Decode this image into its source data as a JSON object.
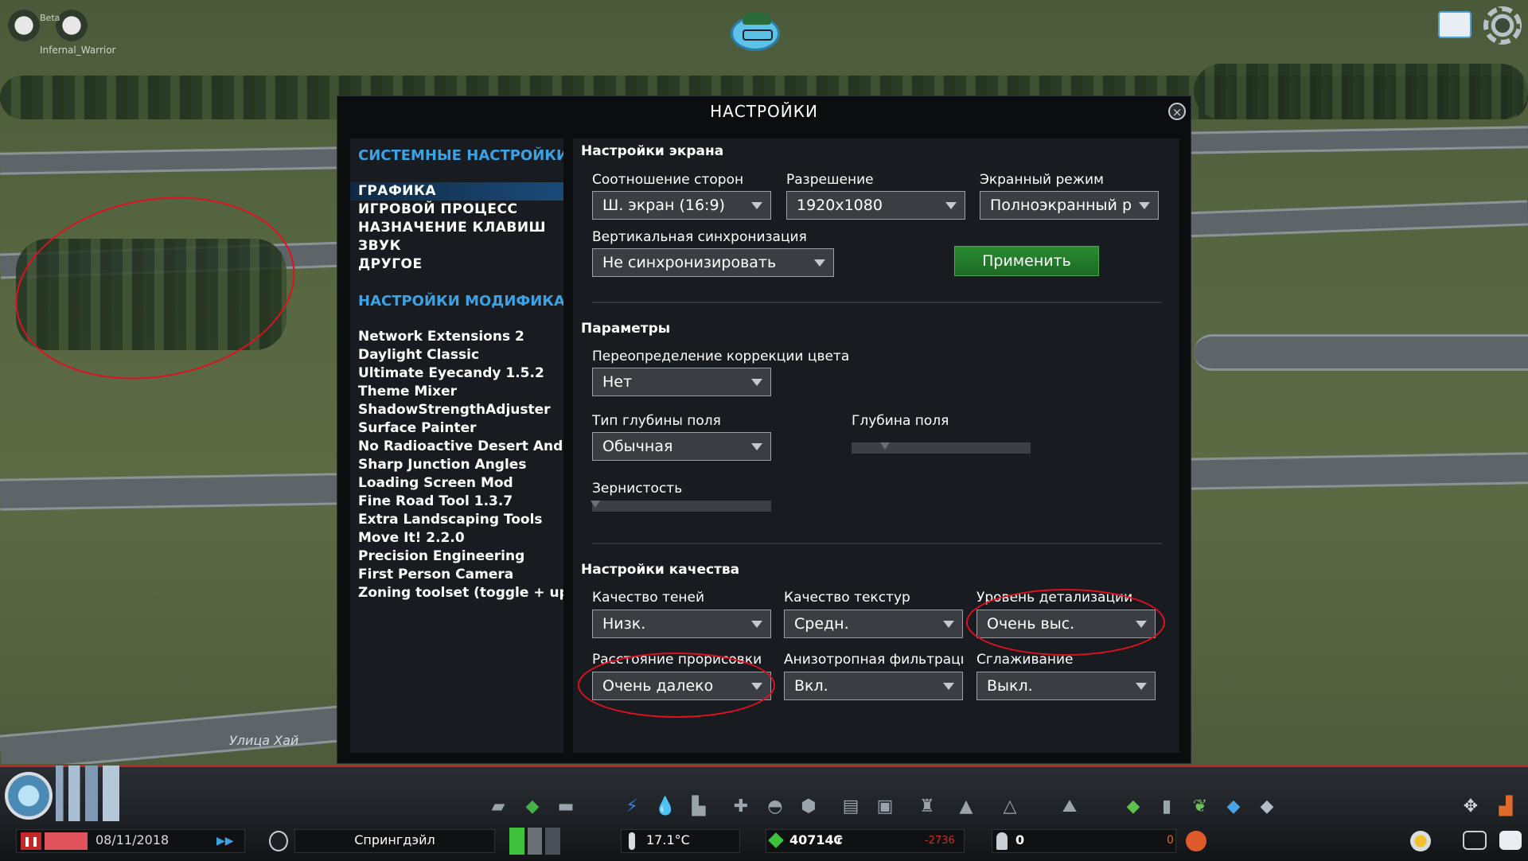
{
  "top": {
    "username": "Infernal_Warrior",
    "beta_label": "Beta"
  },
  "world": {
    "street_name": "Улица Хай"
  },
  "dialog": {
    "title": "НАСТРОЙКИ",
    "close_symbol": "×",
    "nav": {
      "system_header": "СИСТЕМНЫЕ НАСТРОЙКИ",
      "items": [
        "ГРАФИКА",
        "ИГРОВОЙ ПРОЦЕСС",
        "НАЗНАЧЕНИЕ КЛАВИШ",
        "ЗВУК",
        "ДРУГОЕ"
      ],
      "active_index": 0,
      "mods_header": "НАСТРОЙКИ МОДИФИКАЦИЙ",
      "mods": [
        "Network Extensions 2",
        "Daylight Classic",
        "Ultimate Eyecandy 1.5.2",
        "Theme Mixer",
        "ShadowStrengthAdjuster",
        "Surface Painter",
        "No Radioactive Desert And More",
        "Sharp Junction Angles",
        "Loading Screen Mod",
        "Fine Road Tool 1.3.7",
        "Extra Landscaping Tools",
        "Move It! 2.2.0",
        "Precision Engineering",
        "First Person Camera",
        "Zoning toolset (toggle + upgrade)"
      ]
    },
    "screen": {
      "title": "Настройки экрана",
      "aspect_label": "Соотношение сторон",
      "aspect_value": "Ш. экран (16:9)",
      "resolution_label": "Разрешение",
      "resolution_value": "1920x1080",
      "mode_label": "Экранный режим",
      "mode_value": "Полноэкранный режим",
      "vsync_label": "Вертикальная синхронизация",
      "vsync_value": "Не синхронизировать",
      "apply_label": "Применить"
    },
    "params": {
      "title": "Параметры",
      "color_label": "Переопределение коррекции цвета",
      "color_value": "Нет",
      "dof_type_label": "Тип глубины поля",
      "dof_type_value": "Обычная",
      "dof_label": "Глубина поля",
      "grain_label": "Зернистость"
    },
    "quality": {
      "title": "Настройки качества",
      "shadow_label": "Качество теней",
      "shadow_value": "Низк.",
      "texture_label": "Качество текстур",
      "texture_value": "Средн.",
      "lod_label": "Уровень детализации",
      "lod_value": "Очень выс.",
      "draw_label": "Расстояние прорисовки",
      "draw_value": "Очень далеко",
      "aniso_label": "Анизотропная фильтрация",
      "aniso_value": "Вкл.",
      "aa_label": "Сглаживание",
      "aa_value": "Выкл."
    }
  },
  "status_bar": {
    "date": "08/11/2018",
    "city_name": "Спрингдэйл",
    "temperature": "17.1°C",
    "money": "40714₢",
    "income": "-2736",
    "population": "0",
    "unemployment": "0"
  },
  "colors": {
    "accent_blue": "#3aa3e6",
    "apply_green": "#2a8a32",
    "highlight_red": "#e01020"
  }
}
